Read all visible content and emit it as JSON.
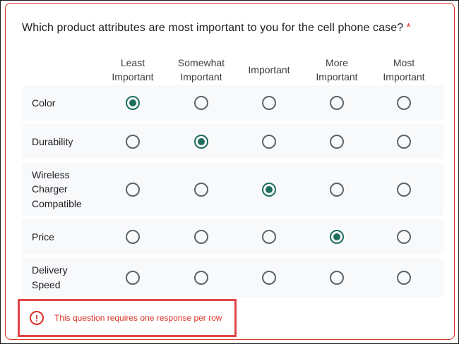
{
  "question": {
    "text": "Which product attributes are most important to you for the cell phone case?",
    "required_mark": "*"
  },
  "columns": [
    {
      "line1": "Least",
      "line2": "Important"
    },
    {
      "line1": "Somewhat",
      "line2": "Important"
    },
    {
      "line1": "Important",
      "line2": ""
    },
    {
      "line1": "More",
      "line2": "Important"
    },
    {
      "line1": "Most",
      "line2": "Important"
    }
  ],
  "rows": [
    {
      "lines": [
        "Color"
      ],
      "selected": 0
    },
    {
      "lines": [
        "Durability"
      ],
      "selected": 1
    },
    {
      "lines": [
        "Wireless",
        "Charger",
        "Compatible"
      ],
      "selected": 2
    },
    {
      "lines": [
        "Price"
      ],
      "selected": 3
    },
    {
      "lines": [
        "Delivery",
        "Speed"
      ],
      "selected": null
    }
  ],
  "error": {
    "icon": "error-circle-icon",
    "message": "This question requires one response per row"
  },
  "colors": {
    "accent": "#1e6e5e",
    "error": "#d93025"
  }
}
